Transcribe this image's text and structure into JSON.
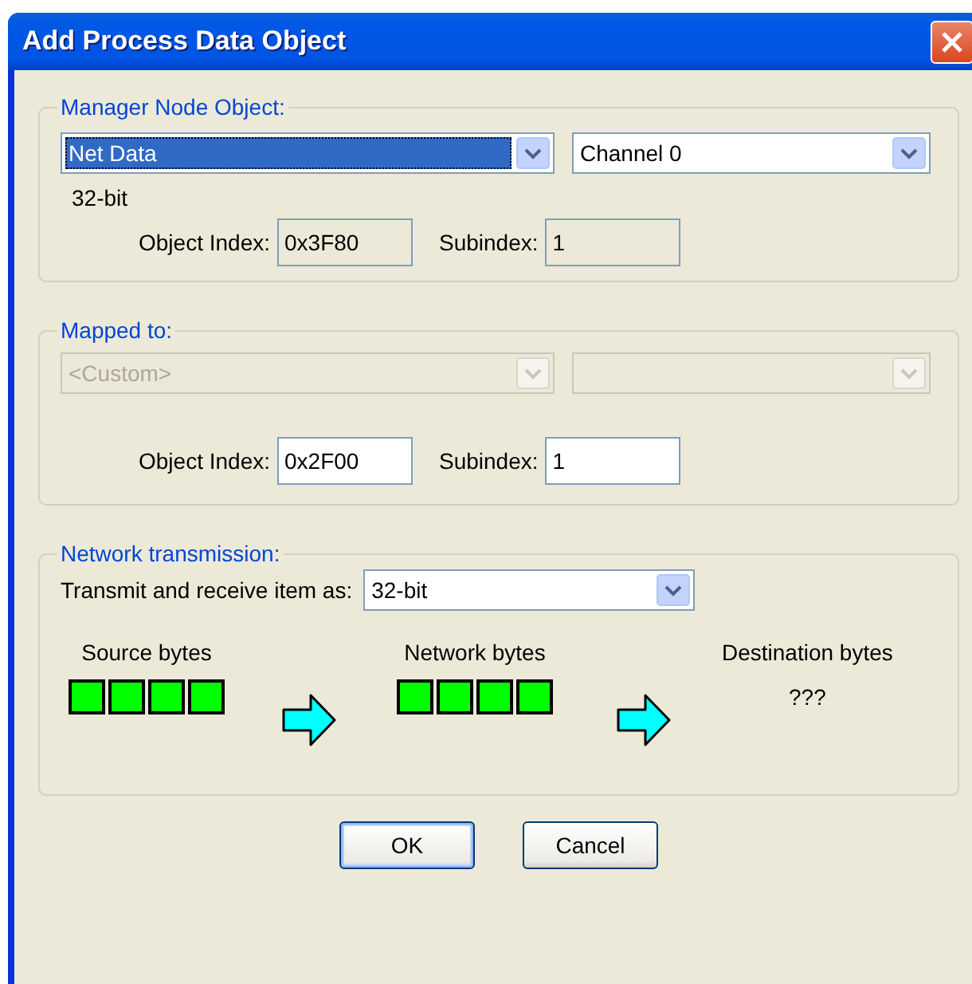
{
  "window": {
    "title": "Add Process Data Object"
  },
  "manager_node_object": {
    "label": "Manager Node Object:",
    "object": {
      "value": "Net Data",
      "selected": true,
      "disabled": false
    },
    "channel": {
      "value": "Channel 0",
      "selected": false,
      "disabled": false
    },
    "size": "32-bit",
    "object_index": {
      "label": "Object Index:",
      "value": "0x3F80",
      "read_only": true
    },
    "subindex": {
      "label": "Subindex:",
      "value": "1",
      "read_only": true
    }
  },
  "mapped_to": {
    "label": "Mapped to:",
    "object": {
      "value": "<Custom>",
      "selected": false,
      "disabled": true
    },
    "channel": {
      "selected": false,
      "disabled": true
    },
    "object_index": {
      "label": "Object Index:",
      "value": "0x2F00",
      "read_only": false
    },
    "subindex": {
      "label": "Subindex:",
      "value": "1",
      "read_only": false
    }
  },
  "network_transmission": {
    "label": "Network transmission:",
    "format_label": "Transmit and receive item as:",
    "format": {
      "value": "32-bit",
      "selected": false,
      "disabled": false
    },
    "source": {
      "label": "Source bytes",
      "bytes": [
        {
          "filled": true
        },
        {
          "filled": true
        },
        {
          "filled": true
        },
        {
          "filled": true
        }
      ]
    },
    "network": {
      "label": "Network bytes",
      "bytes": [
        {
          "filled": true
        },
        {
          "filled": true
        },
        {
          "filled": true
        },
        {
          "filled": true
        }
      ]
    },
    "destination": {
      "label": "Destination bytes",
      "value": "???"
    }
  },
  "buttons": [
    {
      "label": "OK",
      "default": true
    },
    {
      "label": "Cancel",
      "default": false
    }
  ]
}
